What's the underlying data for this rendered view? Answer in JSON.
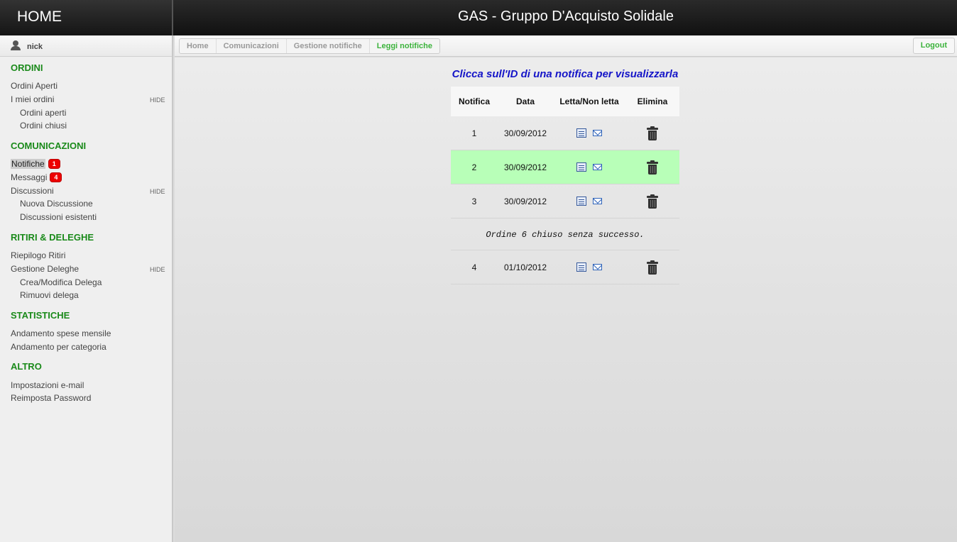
{
  "header": {
    "home": "HOME",
    "title": "GAS - Gruppo D'Acquisto Solidale"
  },
  "user": {
    "name": "nick"
  },
  "sidebar": {
    "ordini": {
      "title": "ORDINI",
      "ordini_aperti": "Ordini Aperti",
      "miei_ordini": "I miei ordini",
      "hide": "HIDE",
      "sub_aperti": "Ordini aperti",
      "sub_chiusi": "Ordini chiusi"
    },
    "comunicazioni": {
      "title": "COMUNICAZIONI",
      "notifiche": "Notifiche",
      "notifiche_count": "1",
      "messaggi": "Messaggi",
      "messaggi_count": "4",
      "discussioni": "Discussioni",
      "hide": "HIDE",
      "nuova": "Nuova Discussione",
      "esistenti": "Discussioni esistenti"
    },
    "ritiri": {
      "title": "RITIRI & DELEGHE",
      "riepilogo": "Riepilogo Ritiri",
      "gestione": "Gestione Deleghe",
      "hide": "HIDE",
      "crea": "Crea/Modifica Delega",
      "rimuovi": "Rimuovi delega"
    },
    "statistiche": {
      "title": "STATISTICHE",
      "mensile": "Andamento spese mensile",
      "categoria": "Andamento per categoria"
    },
    "altro": {
      "title": "ALTRO",
      "email": "Impostazioni e-mail",
      "password": "Reimposta Password"
    }
  },
  "breadcrumb": [
    "Home",
    "Comunicazioni",
    "Gestione notifiche",
    "Leggi notifiche"
  ],
  "logout": "Logout",
  "main": {
    "instruction": "Clicca sull'ID di una notifica per visualizzarla",
    "columns": [
      "Notifica",
      "Data",
      "Letta/Non letta",
      "Elimina"
    ],
    "rows": [
      {
        "id": "1",
        "date": "30/09/2012"
      },
      {
        "id": "2",
        "date": "30/09/2012"
      },
      {
        "id": "3",
        "date": "30/09/2012"
      },
      {
        "id": "4",
        "date": "01/10/2012"
      }
    ],
    "message": "Ordine 6 chiuso senza successo.",
    "icons": {
      "read": "read-document-icon",
      "mail": "envelope-icon",
      "delete": "trash-icon"
    }
  }
}
